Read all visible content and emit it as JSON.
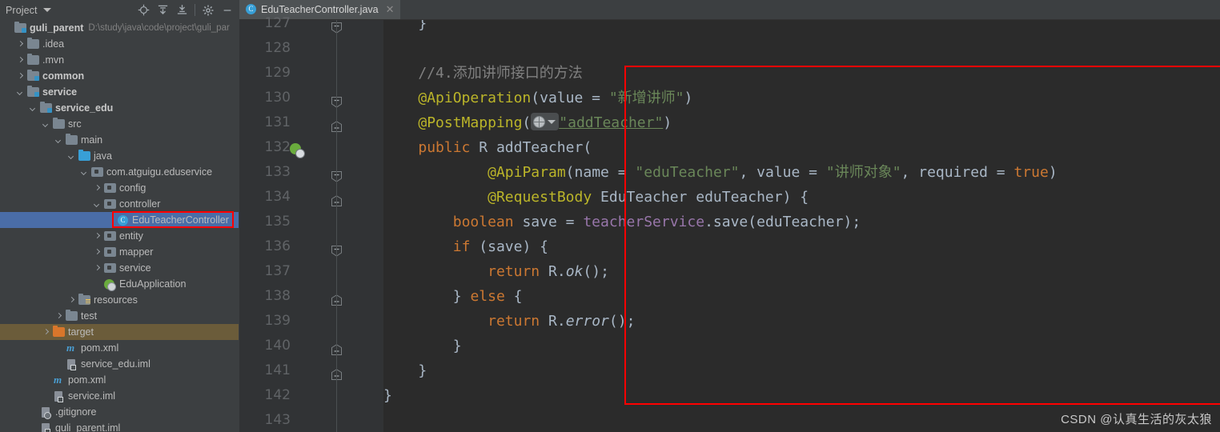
{
  "project_panel": {
    "title": "Project",
    "dropdown_icon": "chevron-down-icon",
    "toolbar": [
      {
        "name": "locate-icon",
        "tooltip": "Select Opened File"
      },
      {
        "name": "expand-all-icon",
        "tooltip": "Expand All"
      },
      {
        "name": "collapse-all-icon",
        "tooltip": "Collapse All"
      },
      {
        "name": "settings-gear-icon",
        "tooltip": "Settings"
      },
      {
        "name": "minimize-icon",
        "tooltip": "Hide"
      }
    ],
    "tree": [
      {
        "label": "guli_parent",
        "path": "D:\\study\\java\\code\\project\\guli_par",
        "indent": 0,
        "arrow": "none",
        "icon": "folder-module",
        "bold": true,
        "state": "normal"
      },
      {
        "label": ".idea",
        "path": "",
        "indent": 1,
        "arrow": "right",
        "icon": "folder",
        "bold": false,
        "state": "normal"
      },
      {
        "label": ".mvn",
        "path": "",
        "indent": 1,
        "arrow": "right",
        "icon": "folder",
        "bold": false,
        "state": "normal"
      },
      {
        "label": "common",
        "path": "",
        "indent": 1,
        "arrow": "right",
        "icon": "folder-module",
        "bold": true,
        "state": "normal"
      },
      {
        "label": "service",
        "path": "",
        "indent": 1,
        "arrow": "down",
        "icon": "folder-module",
        "bold": true,
        "state": "normal"
      },
      {
        "label": "service_edu",
        "path": "",
        "indent": 2,
        "arrow": "down",
        "icon": "folder-module",
        "bold": true,
        "state": "normal"
      },
      {
        "label": "src",
        "path": "",
        "indent": 3,
        "arrow": "down",
        "icon": "folder",
        "bold": false,
        "state": "normal"
      },
      {
        "label": "main",
        "path": "",
        "indent": 4,
        "arrow": "down",
        "icon": "folder",
        "bold": false,
        "state": "normal"
      },
      {
        "label": "java",
        "path": "",
        "indent": 5,
        "arrow": "down",
        "icon": "folder-source",
        "bold": false,
        "state": "normal"
      },
      {
        "label": "com.atguigu.eduservice",
        "path": "",
        "indent": 6,
        "arrow": "down",
        "icon": "package",
        "bold": false,
        "state": "normal"
      },
      {
        "label": "config",
        "path": "",
        "indent": 7,
        "arrow": "right",
        "icon": "package",
        "bold": false,
        "state": "normal"
      },
      {
        "label": "controller",
        "path": "",
        "indent": 7,
        "arrow": "down",
        "icon": "package",
        "bold": false,
        "state": "normal"
      },
      {
        "label": "EduTeacherController",
        "path": "",
        "indent": 8,
        "arrow": "none",
        "icon": "java-class",
        "bold": false,
        "state": "selected"
      },
      {
        "label": "entity",
        "path": "",
        "indent": 7,
        "arrow": "right",
        "icon": "package",
        "bold": false,
        "state": "normal"
      },
      {
        "label": "mapper",
        "path": "",
        "indent": 7,
        "arrow": "right",
        "icon": "package",
        "bold": false,
        "state": "normal"
      },
      {
        "label": "service",
        "path": "",
        "indent": 7,
        "arrow": "right",
        "icon": "package",
        "bold": false,
        "state": "normal"
      },
      {
        "label": "EduApplication",
        "path": "",
        "indent": 7,
        "arrow": "none",
        "icon": "spring-boot-class",
        "bold": false,
        "state": "normal"
      },
      {
        "label": "resources",
        "path": "",
        "indent": 5,
        "arrow": "right",
        "icon": "folder-resources",
        "bold": false,
        "state": "normal"
      },
      {
        "label": "test",
        "path": "",
        "indent": 4,
        "arrow": "right",
        "icon": "folder",
        "bold": false,
        "state": "normal"
      },
      {
        "label": "target",
        "path": "",
        "indent": 3,
        "arrow": "right",
        "icon": "folder-target",
        "bold": false,
        "state": "excluded"
      },
      {
        "label": "pom.xml",
        "path": "",
        "indent": 4,
        "arrow": "none",
        "icon": "maven",
        "bold": false,
        "state": "normal"
      },
      {
        "label": "service_edu.iml",
        "path": "",
        "indent": 4,
        "arrow": "none",
        "icon": "iml",
        "bold": false,
        "state": "normal"
      },
      {
        "label": "pom.xml",
        "path": "",
        "indent": 3,
        "arrow": "none",
        "icon": "maven",
        "bold": false,
        "state": "normal"
      },
      {
        "label": "service.iml",
        "path": "",
        "indent": 3,
        "arrow": "none",
        "icon": "iml",
        "bold": false,
        "state": "normal"
      },
      {
        "label": ".gitignore",
        "path": "",
        "indent": 2,
        "arrow": "none",
        "icon": "gitignore",
        "bold": false,
        "state": "normal"
      },
      {
        "label": "guli_parent.iml",
        "path": "",
        "indent": 2,
        "arrow": "none",
        "icon": "iml",
        "bold": false,
        "state": "normal"
      }
    ]
  },
  "editor": {
    "tab": {
      "label": "EduTeacherController.java",
      "icon": "java-class-icon",
      "close_icon": "close-icon",
      "active": true
    },
    "line_numbers": [
      "127",
      "128",
      "129",
      "130",
      "131",
      "132",
      "133",
      "134",
      "135",
      "136",
      "137",
      "138",
      "139",
      "140",
      "141",
      "142",
      "143"
    ],
    "gutter_run_marker": {
      "line": "132",
      "icon": "spring-request-mapping-icon"
    },
    "fold_markers": [
      {
        "line": "127",
        "type": "end"
      },
      {
        "line": "130",
        "type": "end"
      },
      {
        "line": "131",
        "type": "start"
      },
      {
        "line": "133",
        "type": "end"
      },
      {
        "line": "134",
        "type": "start"
      },
      {
        "line": "136",
        "type": "end"
      },
      {
        "line": "138",
        "type": "start"
      },
      {
        "line": "140",
        "type": "start"
      },
      {
        "line": "141",
        "type": "start"
      }
    ],
    "code_lines": [
      {
        "line": "127",
        "text": "    }"
      },
      {
        "line": "128",
        "text": ""
      },
      {
        "line": "129",
        "text": "    //4.添加讲师接口的方法"
      },
      {
        "line": "130",
        "text": "    @ApiOperation(value = \"新增讲师\")"
      },
      {
        "line": "131",
        "text": "    @PostMapping(\"addTeacher\")"
      },
      {
        "line": "132",
        "text": "    public R addTeacher("
      },
      {
        "line": "133",
        "text": "            @ApiParam(name = \"eduTeacher\", value = \"讲师对象\", required = true)"
      },
      {
        "line": "134",
        "text": "            @RequestBody EduTeacher eduTeacher) {"
      },
      {
        "line": "135",
        "text": "        boolean save = teacherService.save(eduTeacher);"
      },
      {
        "line": "136",
        "text": "        if (save) {"
      },
      {
        "line": "137",
        "text": "            return R.ok();"
      },
      {
        "line": "138",
        "text": "        } else {"
      },
      {
        "line": "139",
        "text": "            return R.error();"
      },
      {
        "line": "140",
        "text": "        }"
      },
      {
        "line": "141",
        "text": "    }"
      },
      {
        "line": "142",
        "text": "}"
      },
      {
        "line": "143",
        "text": ""
      }
    ],
    "inline_hint": {
      "icon": "globe-icon",
      "chevron": "chevron-down-icon",
      "on_line": "131"
    }
  },
  "annotations": {
    "code_box_color": "#ff0000",
    "tree_box_color": "#ff0000"
  },
  "watermark": {
    "text": "CSDN @认真生活的灰太狼"
  },
  "colors": {
    "panel_bg": "#3c3f41",
    "editor_bg": "#2b2b2b",
    "gutter_bg": "#313335",
    "selection_blue": "#4a6da7",
    "excluded_brown": "#6b5c3a",
    "keyword": "#cc7832",
    "annotation": "#bbb529",
    "string": "#6a8759",
    "comment": "#808080",
    "field": "#9876aa",
    "default_text": "#a9b7c6"
  }
}
